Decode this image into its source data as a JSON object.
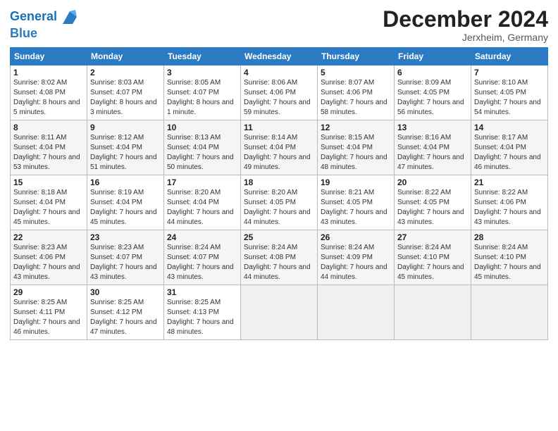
{
  "header": {
    "logo_line1": "General",
    "logo_line2": "Blue",
    "month_title": "December 2024",
    "location": "Jerxheim, Germany"
  },
  "days_of_week": [
    "Sunday",
    "Monday",
    "Tuesday",
    "Wednesday",
    "Thursday",
    "Friday",
    "Saturday"
  ],
  "weeks": [
    [
      {
        "day": "1",
        "sunrise": "8:02 AM",
        "sunset": "4:08 PM",
        "daylight": "8 hours and 5 minutes."
      },
      {
        "day": "2",
        "sunrise": "8:03 AM",
        "sunset": "4:07 PM",
        "daylight": "8 hours and 3 minutes."
      },
      {
        "day": "3",
        "sunrise": "8:05 AM",
        "sunset": "4:07 PM",
        "daylight": "8 hours and 1 minute."
      },
      {
        "day": "4",
        "sunrise": "8:06 AM",
        "sunset": "4:06 PM",
        "daylight": "7 hours and 59 minutes."
      },
      {
        "day": "5",
        "sunrise": "8:07 AM",
        "sunset": "4:06 PM",
        "daylight": "7 hours and 58 minutes."
      },
      {
        "day": "6",
        "sunrise": "8:09 AM",
        "sunset": "4:05 PM",
        "daylight": "7 hours and 56 minutes."
      },
      {
        "day": "7",
        "sunrise": "8:10 AM",
        "sunset": "4:05 PM",
        "daylight": "7 hours and 54 minutes."
      }
    ],
    [
      {
        "day": "8",
        "sunrise": "8:11 AM",
        "sunset": "4:04 PM",
        "daylight": "7 hours and 53 minutes."
      },
      {
        "day": "9",
        "sunrise": "8:12 AM",
        "sunset": "4:04 PM",
        "daylight": "7 hours and 51 minutes."
      },
      {
        "day": "10",
        "sunrise": "8:13 AM",
        "sunset": "4:04 PM",
        "daylight": "7 hours and 50 minutes."
      },
      {
        "day": "11",
        "sunrise": "8:14 AM",
        "sunset": "4:04 PM",
        "daylight": "7 hours and 49 minutes."
      },
      {
        "day": "12",
        "sunrise": "8:15 AM",
        "sunset": "4:04 PM",
        "daylight": "7 hours and 48 minutes."
      },
      {
        "day": "13",
        "sunrise": "8:16 AM",
        "sunset": "4:04 PM",
        "daylight": "7 hours and 47 minutes."
      },
      {
        "day": "14",
        "sunrise": "8:17 AM",
        "sunset": "4:04 PM",
        "daylight": "7 hours and 46 minutes."
      }
    ],
    [
      {
        "day": "15",
        "sunrise": "8:18 AM",
        "sunset": "4:04 PM",
        "daylight": "7 hours and 45 minutes."
      },
      {
        "day": "16",
        "sunrise": "8:19 AM",
        "sunset": "4:04 PM",
        "daylight": "7 hours and 45 minutes."
      },
      {
        "day": "17",
        "sunrise": "8:20 AM",
        "sunset": "4:04 PM",
        "daylight": "7 hours and 44 minutes."
      },
      {
        "day": "18",
        "sunrise": "8:20 AM",
        "sunset": "4:05 PM",
        "daylight": "7 hours and 44 minutes."
      },
      {
        "day": "19",
        "sunrise": "8:21 AM",
        "sunset": "4:05 PM",
        "daylight": "7 hours and 43 minutes."
      },
      {
        "day": "20",
        "sunrise": "8:22 AM",
        "sunset": "4:05 PM",
        "daylight": "7 hours and 43 minutes."
      },
      {
        "day": "21",
        "sunrise": "8:22 AM",
        "sunset": "4:06 PM",
        "daylight": "7 hours and 43 minutes."
      }
    ],
    [
      {
        "day": "22",
        "sunrise": "8:23 AM",
        "sunset": "4:06 PM",
        "daylight": "7 hours and 43 minutes."
      },
      {
        "day": "23",
        "sunrise": "8:23 AM",
        "sunset": "4:07 PM",
        "daylight": "7 hours and 43 minutes."
      },
      {
        "day": "24",
        "sunrise": "8:24 AM",
        "sunset": "4:07 PM",
        "daylight": "7 hours and 43 minutes."
      },
      {
        "day": "25",
        "sunrise": "8:24 AM",
        "sunset": "4:08 PM",
        "daylight": "7 hours and 44 minutes."
      },
      {
        "day": "26",
        "sunrise": "8:24 AM",
        "sunset": "4:09 PM",
        "daylight": "7 hours and 44 minutes."
      },
      {
        "day": "27",
        "sunrise": "8:24 AM",
        "sunset": "4:10 PM",
        "daylight": "7 hours and 45 minutes."
      },
      {
        "day": "28",
        "sunrise": "8:24 AM",
        "sunset": "4:10 PM",
        "daylight": "7 hours and 45 minutes."
      }
    ],
    [
      {
        "day": "29",
        "sunrise": "8:25 AM",
        "sunset": "4:11 PM",
        "daylight": "7 hours and 46 minutes."
      },
      {
        "day": "30",
        "sunrise": "8:25 AM",
        "sunset": "4:12 PM",
        "daylight": "7 hours and 47 minutes."
      },
      {
        "day": "31",
        "sunrise": "8:25 AM",
        "sunset": "4:13 PM",
        "daylight": "7 hours and 48 minutes."
      },
      null,
      null,
      null,
      null
    ]
  ]
}
